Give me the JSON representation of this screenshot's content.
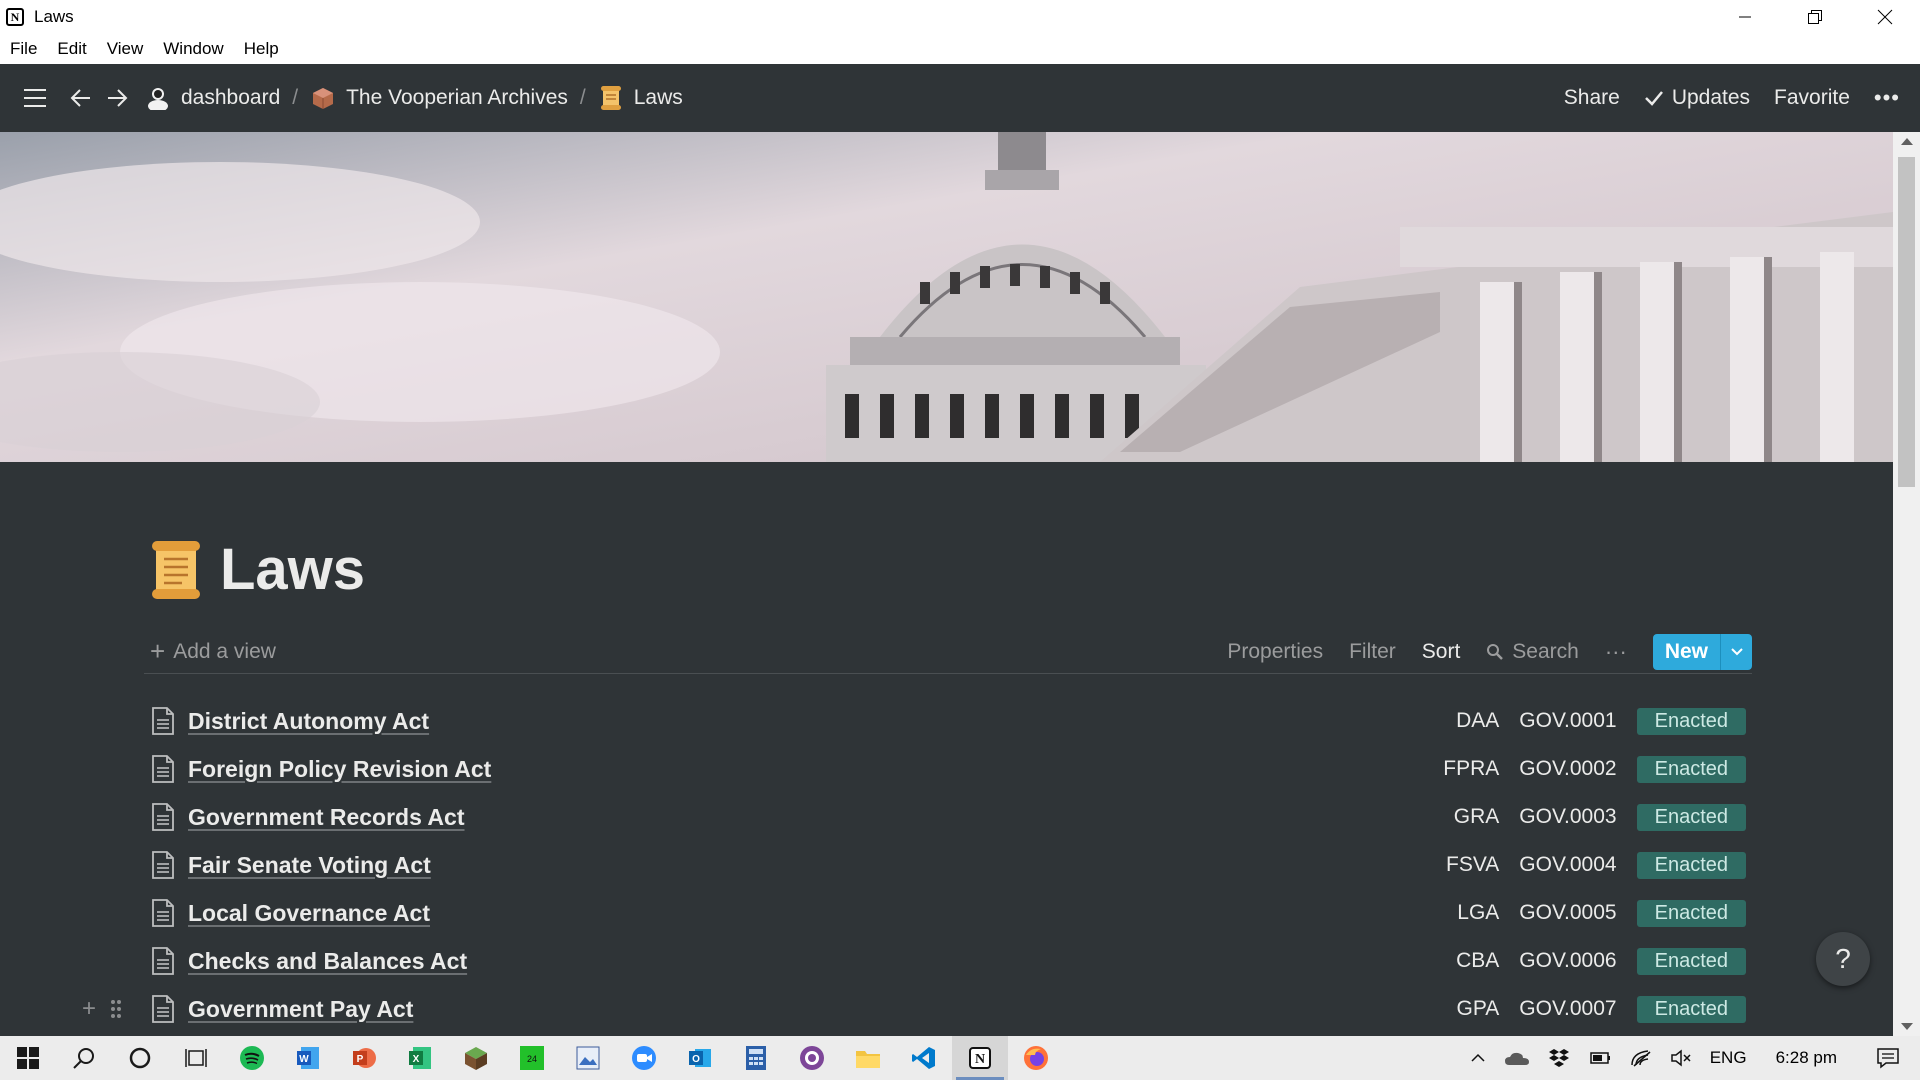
{
  "window": {
    "title": "Laws",
    "app_icon_letter": "N"
  },
  "menu": [
    "File",
    "Edit",
    "View",
    "Window",
    "Help"
  ],
  "breadcrumb": [
    {
      "label": "dashboard",
      "icon": "user-avatar-icon"
    },
    {
      "label": "The Vooperian Archives",
      "icon": "package-icon"
    },
    {
      "label": "Laws",
      "icon": "scroll-icon"
    }
  ],
  "breadcrumb_separator": "/",
  "topbar_actions": {
    "share": "Share",
    "updates": "Updates",
    "favorite": "Favorite",
    "more": "•••"
  },
  "page": {
    "title": "Laws",
    "icon": "scroll-icon"
  },
  "view_bar": {
    "add_view": "Add a view",
    "properties": "Properties",
    "filter": "Filter",
    "sort": "Sort",
    "search": "Search",
    "more": "···",
    "new": "New"
  },
  "rows": [
    {
      "name": "District Autonomy Act",
      "abbr": "DAA",
      "code": "GOV.0001",
      "status": "Enacted"
    },
    {
      "name": "Foreign Policy Revision Act",
      "abbr": "FPRA",
      "code": "GOV.0002",
      "status": "Enacted"
    },
    {
      "name": "Government Records Act",
      "abbr": "GRA",
      "code": "GOV.0003",
      "status": "Enacted"
    },
    {
      "name": "Fair Senate Voting Act",
      "abbr": "FSVA",
      "code": "GOV.0004",
      "status": "Enacted"
    },
    {
      "name": "Local Governance Act",
      "abbr": "LGA",
      "code": "GOV.0005",
      "status": "Enacted"
    },
    {
      "name": "Checks and Balances Act",
      "abbr": "CBA",
      "code": "GOV.0006",
      "status": "Enacted"
    },
    {
      "name": "Government Pay Act",
      "abbr": "GPA",
      "code": "GOV.0007",
      "status": "Enacted"
    }
  ],
  "help_label": "?",
  "taskbar": {
    "apps": [
      "windows-start-icon",
      "search-icon",
      "cortana-icon",
      "task-view-icon",
      "spotify-icon",
      "word-icon",
      "powerpoint-icon",
      "excel-icon",
      "minecraft-icon",
      "game-app-icon",
      "photo-app-icon",
      "zoom-icon",
      "outlook-icon",
      "calculator-icon",
      "tor-icon",
      "file-explorer-icon",
      "vscode-icon",
      "notion-icon",
      "firefox-icon"
    ],
    "language": "ENG",
    "time": "6:28 pm"
  },
  "colors": {
    "background": "#2f3437",
    "accent": "#2eaadc",
    "status_enacted_bg": "#2f6b63"
  }
}
